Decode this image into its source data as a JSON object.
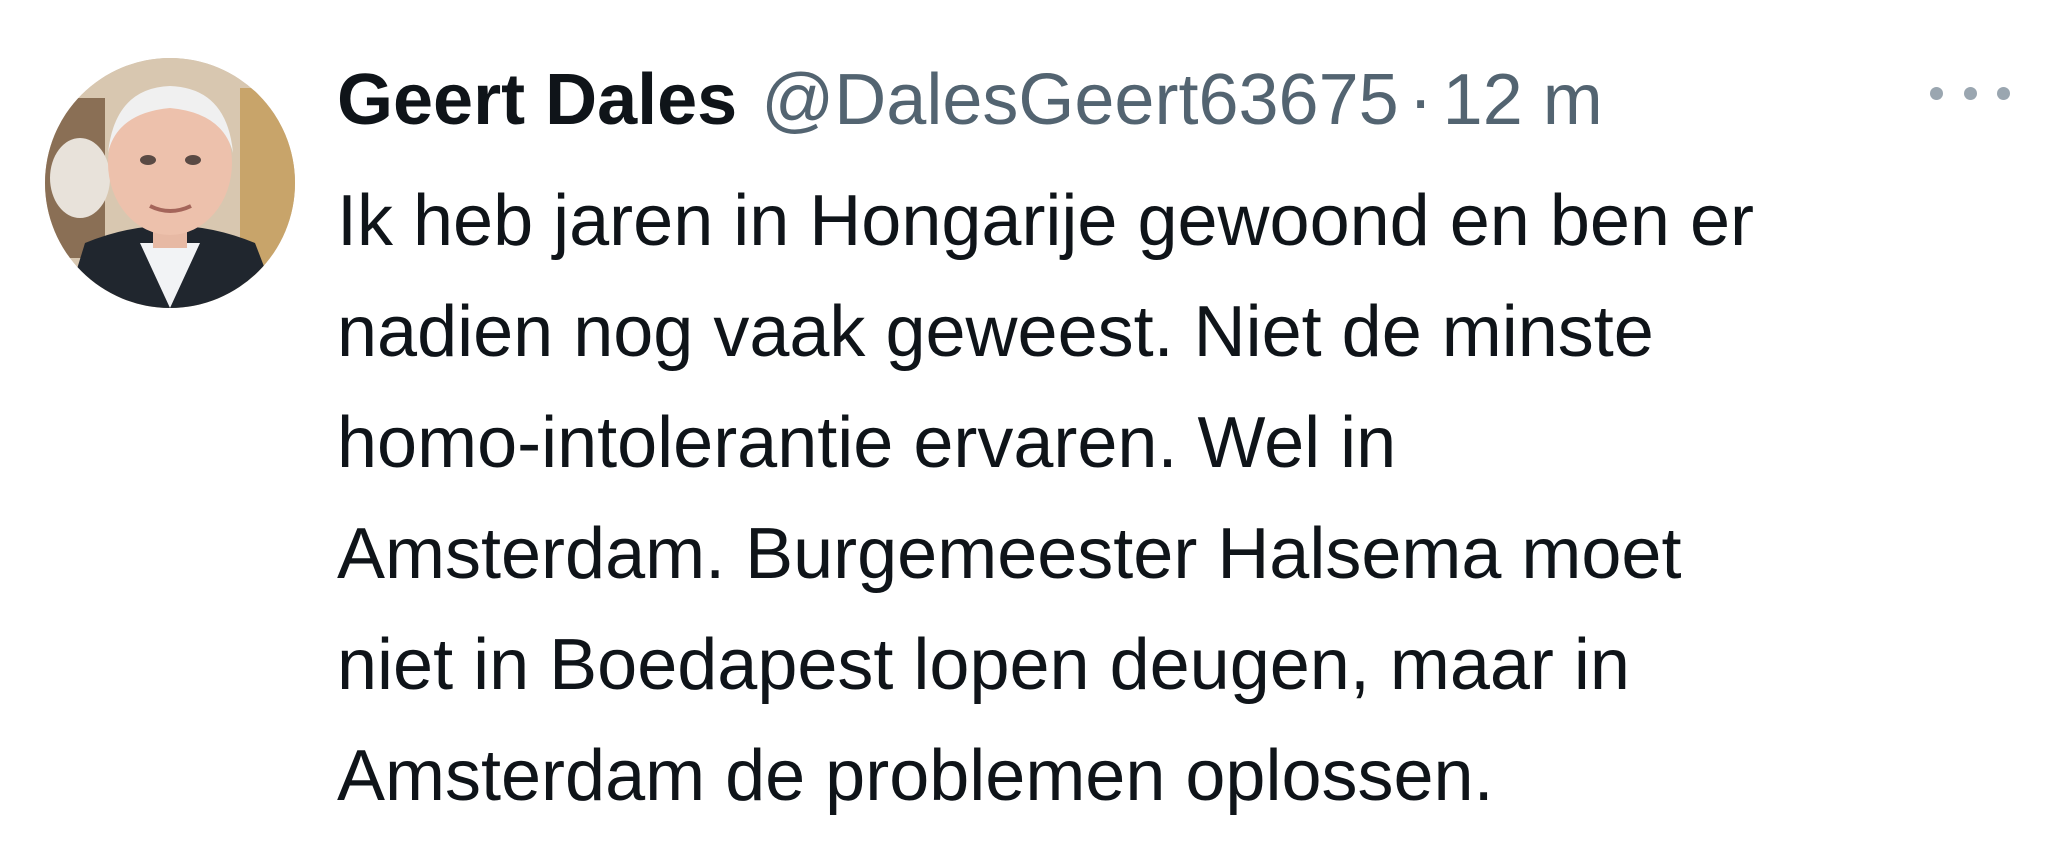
{
  "tweet": {
    "author": {
      "display_name": "Geert Dales",
      "handle": "@DalesGeert63675"
    },
    "separator": "·",
    "timestamp": "12 m",
    "text_lines": [
      "Ik heb jaren in Hongarije gewoond en ben er",
      "nadien nog vaak geweest. Niet de minste",
      "homo-intolerantie ervaren. Wel in",
      "Amsterdam. Burgemeester Halsema moet",
      "niet in Boedapest lopen deugen, maar in",
      "Amsterdam de problemen oplossen."
    ],
    "more_icon": "more-horizontal-icon"
  },
  "colors": {
    "text_primary": "#0f1419",
    "text_secondary": "#536471",
    "background": "#ffffff"
  }
}
